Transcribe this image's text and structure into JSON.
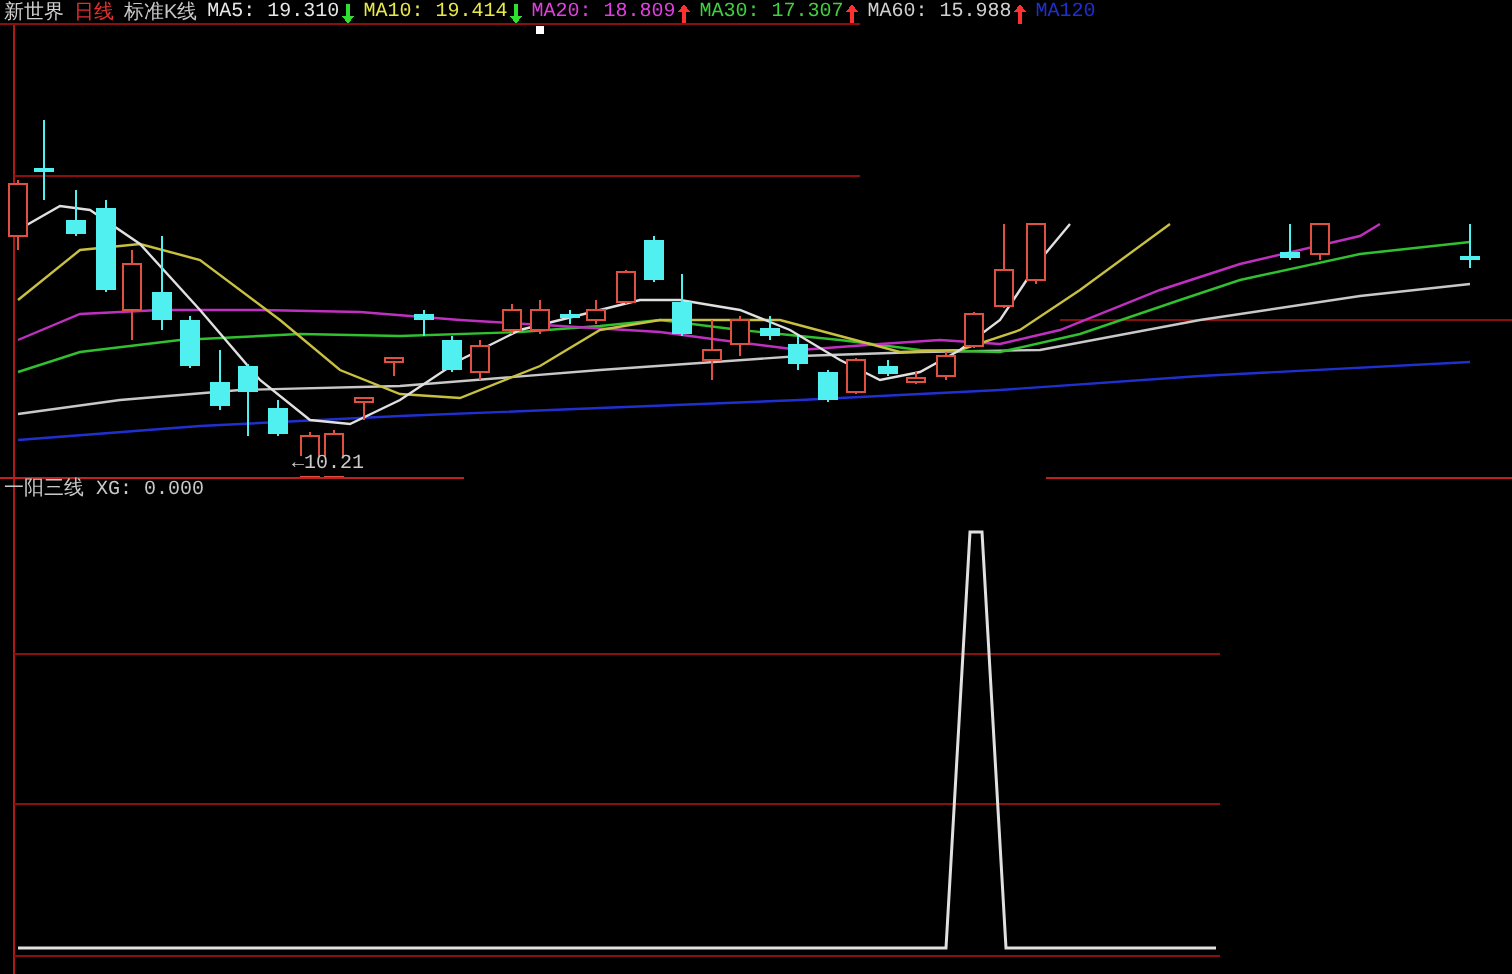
{
  "header": {
    "stock": "新世界",
    "period": "日线",
    "chart_type": "标准K线",
    "averages": [
      {
        "label": "MA5:",
        "value": "19.310",
        "arrow": {
          "rising": false,
          "color": "#30e030"
        },
        "color": "#e8e8e8"
      },
      {
        "label": "MA10:",
        "value": "19.414",
        "arrow": {
          "rising": false,
          "color": "#30e030"
        },
        "color": "#e8e84a"
      },
      {
        "label": "MA20:",
        "value": "18.809",
        "arrow": {
          "rising": true,
          "color": "#ff3030"
        },
        "color": "#e040e0"
      },
      {
        "label": "MA30:",
        "value": "17.307",
        "arrow": {
          "rising": true,
          "color": "#ff3030"
        },
        "color": "#40d040"
      },
      {
        "label": "MA60:",
        "value": "15.988",
        "arrow": {
          "rising": true,
          "color": "#ff3030"
        },
        "color": "#d0d0d0"
      },
      {
        "label": "MA120",
        "color": "#2030d0"
      }
    ]
  },
  "low_marker": {
    "arrow": "←",
    "value": "10.21"
  },
  "indicator": {
    "name": "一阳三线",
    "reading": "XG: 0.000"
  }
}
